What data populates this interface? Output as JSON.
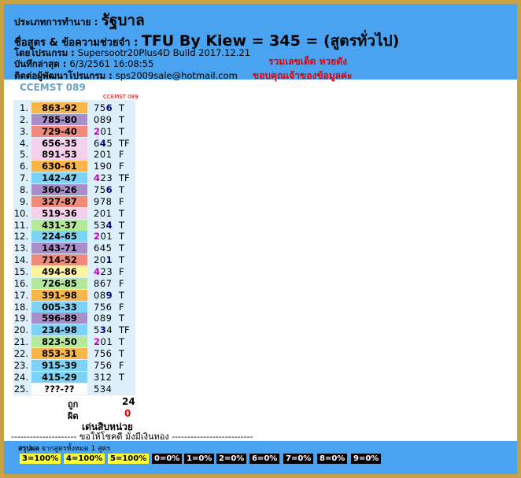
{
  "header": {
    "type_label": "ประเภทการทำนาย :",
    "type_value": "รัฐบาล",
    "formula_label": "ชื่อสูตร & ข้อความช่วยจำ :",
    "formula_value": "TFU By Kiew = 345 = (สูตรทั่วไป)",
    "program_label": "โดยโปรแกรม :",
    "program_value": "Supersootr20Plus4D Build 2017.12.21",
    "saved_label": "บันทึกล่าสุด :",
    "saved_value": "6/3/2561 16:08:55",
    "contact_label": "ติดต่อผู้พัฒนาโปรแกรม :",
    "contact_value": "sps2009sale@hotmail.com",
    "promo1": "รวมเลขเด็ด หวยดัง",
    "promo2": "ขอบคุณเจ้าของข้อมูลค่ะ"
  },
  "section_title": "CCEMST 089",
  "column_label": "CCEMST 089",
  "rows": [
    {
      "n": "1.",
      "pair": "863-92",
      "color": "#f7b54a",
      "code": [
        "7",
        "5",
        "6"
      ],
      "hl": [
        false,
        false,
        true
      ],
      "mark": "T"
    },
    {
      "n": "2.",
      "pair": "785-80",
      "color": "#a98fc9",
      "code": [
        "0",
        "8",
        "9"
      ],
      "hl": [
        false,
        false,
        false
      ],
      "mark": "T"
    },
    {
      "n": "3.",
      "pair": "729-40",
      "color": "#f08a7a",
      "code": [
        "2",
        "0",
        "1"
      ],
      "hl": [
        true,
        false,
        false
      ],
      "mark": "T"
    },
    {
      "n": "4.",
      "pair": "656-35",
      "color": "#f4d0ea",
      "code": [
        "6",
        "4",
        "5"
      ],
      "hl": [
        false,
        true,
        false
      ],
      "mark": "TF"
    },
    {
      "n": "5.",
      "pair": "891-53",
      "color": "#f4d0ea",
      "code": [
        "2",
        "0",
        "1"
      ],
      "hl": [
        false,
        false,
        false
      ],
      "mark": "F"
    },
    {
      "n": "6.",
      "pair": "630-61",
      "color": "#f7b54a",
      "code": [
        "1",
        "9",
        "0"
      ],
      "hl": [
        false,
        false,
        false
      ],
      "mark": "F"
    },
    {
      "n": "7.",
      "pair": "142-47",
      "color": "#7dd3f5",
      "code": [
        "4",
        "2",
        "3"
      ],
      "hl": [
        true,
        false,
        false
      ],
      "mark": "TF"
    },
    {
      "n": "8.",
      "pair": "360-26",
      "color": "#a98fc9",
      "code": [
        "7",
        "5",
        "6"
      ],
      "hl": [
        false,
        false,
        true
      ],
      "mark": "T"
    },
    {
      "n": "9.",
      "pair": "327-87",
      "color": "#f08a7a",
      "code": [
        "9",
        "7",
        "8"
      ],
      "hl": [
        false,
        false,
        false
      ],
      "mark": "F"
    },
    {
      "n": "10.",
      "pair": "519-36",
      "color": "#f4d0ea",
      "code": [
        "2",
        "0",
        "1"
      ],
      "hl": [
        false,
        false,
        false
      ],
      "mark": "T"
    },
    {
      "n": "11.",
      "pair": "431-37",
      "color": "#b4e89a",
      "code": [
        "5",
        "3",
        "4"
      ],
      "hl": [
        false,
        false,
        true
      ],
      "mark": "T"
    },
    {
      "n": "12.",
      "pair": "224-65",
      "color": "#7dd3f5",
      "code": [
        "2",
        "0",
        "1"
      ],
      "hl": [
        true,
        false,
        false
      ],
      "mark": "T"
    },
    {
      "n": "13.",
      "pair": "143-71",
      "color": "#a98fc9",
      "code": [
        "6",
        "4",
        "5"
      ],
      "hl": [
        false,
        false,
        false
      ],
      "mark": "T"
    },
    {
      "n": "14.",
      "pair": "714-52",
      "color": "#f08a7a",
      "code": [
        "2",
        "0",
        "1"
      ],
      "hl": [
        false,
        false,
        true
      ],
      "mark": "T"
    },
    {
      "n": "15.",
      "pair": "494-86",
      "color": "#fff3a0",
      "code": [
        "4",
        "2",
        "3"
      ],
      "hl": [
        true,
        false,
        false
      ],
      "mark": "F"
    },
    {
      "n": "16.",
      "pair": "726-85",
      "color": "#b4e89a",
      "code": [
        "8",
        "6",
        "7"
      ],
      "hl": [
        false,
        false,
        false
      ],
      "mark": "F"
    },
    {
      "n": "17.",
      "pair": "391-98",
      "color": "#f7b54a",
      "code": [
        "0",
        "8",
        "9"
      ],
      "hl": [
        false,
        false,
        true
      ],
      "mark": "T"
    },
    {
      "n": "18.",
      "pair": "005-33",
      "color": "#7dd3f5",
      "code": [
        "7",
        "5",
        "6"
      ],
      "hl": [
        false,
        false,
        false
      ],
      "mark": "F"
    },
    {
      "n": "19.",
      "pair": "596-89",
      "color": "#a98fc9",
      "code": [
        "0",
        "8",
        "9"
      ],
      "hl": [
        false,
        false,
        false
      ],
      "mark": "T"
    },
    {
      "n": "20.",
      "pair": "234-98",
      "color": "#7dd3f5",
      "code": [
        "5",
        "3",
        "4"
      ],
      "hl": [
        false,
        true,
        false
      ],
      "mark": "TF"
    },
    {
      "n": "21.",
      "pair": "823-50",
      "color": "#b4e89a",
      "code": [
        "2",
        "0",
        "1"
      ],
      "hl": [
        true,
        false,
        false
      ],
      "mark": "T"
    },
    {
      "n": "22.",
      "pair": "853-31",
      "color": "#f7b54a",
      "code": [
        "7",
        "5",
        "6"
      ],
      "hl": [
        false,
        false,
        false
      ],
      "mark": "T"
    },
    {
      "n": "23.",
      "pair": "915-39",
      "color": "#7dd3f5",
      "code": [
        "7",
        "5",
        "6"
      ],
      "hl": [
        false,
        false,
        false
      ],
      "mark": "F"
    },
    {
      "n": "24.",
      "pair": "415-29",
      "color": "#7dd3f5",
      "code": [
        "3",
        "1",
        "2"
      ],
      "hl": [
        false,
        false,
        false
      ],
      "mark": "T"
    },
    {
      "n": "25.",
      "pair": "???-??",
      "color": "#ffffff",
      "code": [
        "5",
        "3",
        "4"
      ],
      "hl": [
        false,
        false,
        false
      ],
      "mark": ""
    }
  ],
  "totals": {
    "correct_label": "ถูก",
    "correct_value": "24",
    "wrong_label": "ผิด",
    "wrong_value": "0",
    "unit_label": "เด่นสิบหน่วย"
  },
  "footer_line": "--------------------- ขอให้โชคดี มั่งมีเงินทอง --------------------------",
  "summary": {
    "title_bold": "สรุปผล",
    "title_rest": " จากสูตรทั้งหมด 1 สูตร",
    "badges": [
      {
        "label": "3=100%",
        "style": "y"
      },
      {
        "label": "4=100%",
        "style": "y"
      },
      {
        "label": "5=100%",
        "style": "y"
      },
      {
        "label": "0=0%",
        "style": "k"
      },
      {
        "label": "1=0%",
        "style": "k"
      },
      {
        "label": "2=0%",
        "style": "k"
      },
      {
        "label": "6=0%",
        "style": "k"
      },
      {
        "label": "7=0%",
        "style": "k"
      },
      {
        "label": "8=0%",
        "style": "k"
      },
      {
        "label": "9=0%",
        "style": "k"
      }
    ]
  },
  "colors": {
    "header_bg": "#4aa3f0",
    "panel_bg": "#dcf0fb",
    "highlight_purple": "#c000c0",
    "highlight_blue": "#00008b",
    "promo_red": "#e60000"
  }
}
